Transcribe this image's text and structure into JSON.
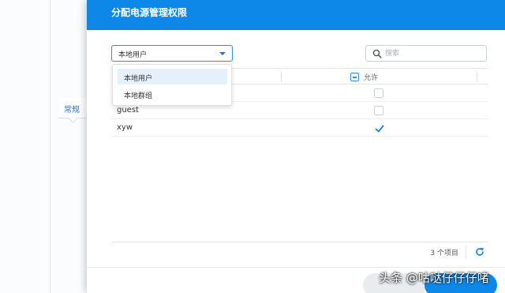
{
  "background": {
    "tab_label": "常规"
  },
  "dialog": {
    "title": "分配电源管理权限",
    "scope_select": {
      "value": "本地用户",
      "options": [
        "本地用户",
        "本地群组"
      ]
    },
    "search": {
      "placeholder": "搜索"
    },
    "table": {
      "columns": [
        "",
        "允许"
      ],
      "rows": [
        {
          "name": "",
          "allowed": false
        },
        {
          "name": "guest",
          "allowed": false
        },
        {
          "name": "xyw",
          "allowed": true
        }
      ]
    },
    "footer": {
      "count_text": "3 个项目"
    }
  },
  "watermark": "头条 @咕哒仔仔仔啫",
  "colors": {
    "accent": "#0e88e8",
    "checkbox": "#2f8de4"
  },
  "icons": {
    "search": "search-icon",
    "refresh": "refresh-icon",
    "caret": "chevron-down-icon"
  }
}
